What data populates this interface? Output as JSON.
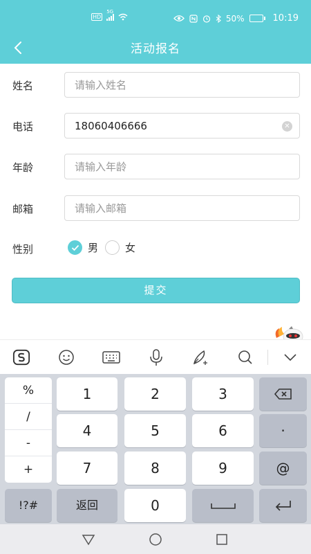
{
  "status_bar": {
    "network_tag": "HD",
    "network_type": "5G",
    "battery": "50%",
    "battery_level": 0.5,
    "time": "10:19"
  },
  "nav": {
    "title": "活动报名"
  },
  "form": {
    "name": {
      "label": "姓名",
      "placeholder": "请输入姓名",
      "value": ""
    },
    "phone": {
      "label": "电话",
      "placeholder": "",
      "value": "18060406666"
    },
    "age": {
      "label": "年龄",
      "placeholder": "请输入年龄",
      "value": ""
    },
    "email": {
      "label": "邮箱",
      "placeholder": "请输入邮箱",
      "value": ""
    },
    "gender": {
      "label": "性别",
      "options": [
        {
          "label": "男",
          "checked": true
        },
        {
          "label": "女",
          "checked": false
        }
      ]
    },
    "submit_label": "提交"
  },
  "ime_toolbar": {
    "icons": [
      "sogou-logo-icon",
      "emoji-icon",
      "keyboard-icon",
      "microphone-icon",
      "handwriting-icon",
      "search-icon",
      "collapse-icon"
    ]
  },
  "keyboard": {
    "symbols": [
      "%",
      "/",
      "-",
      "+"
    ],
    "digits": [
      "1",
      "2",
      "3",
      "4",
      "5",
      "6",
      "7",
      "8",
      "9",
      "0"
    ],
    "backspace": "backspace-icon",
    "dot": "·",
    "at": "@",
    "switch_symbols": "!?#",
    "back": "返回",
    "space": "space-icon",
    "enter": "enter-icon"
  },
  "colors": {
    "accent": "#5ecfd8",
    "keyboard_bg": "#d3d7de",
    "function_key": "#b9bec9"
  }
}
